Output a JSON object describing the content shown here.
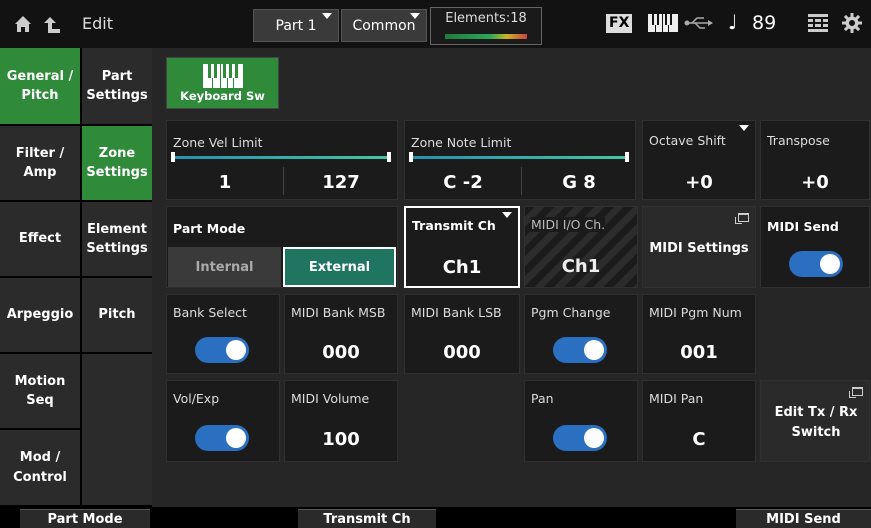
{
  "header": {
    "title": "Edit",
    "part_button": "Part 1",
    "common_button": "Common",
    "elements_label": "Elements:18",
    "fx_label": "FX",
    "note_symbol": "♩",
    "tempo": "89"
  },
  "left_nav": {
    "primary": [
      "General / Pitch",
      "Filter / Amp",
      "Effect",
      "Arpeggio",
      "Motion Seq",
      "Mod / Control"
    ],
    "secondary": [
      "Part Settings",
      "Zone Settings",
      "Element Settings",
      "Pitch"
    ],
    "selected_primary": "General / Pitch",
    "selected_secondary": "Zone Settings"
  },
  "keyboard_sw": {
    "label": "Keyboard Sw"
  },
  "zone_vel_limit": {
    "title": "Zone Vel Limit",
    "low": "1",
    "high": "127"
  },
  "zone_note_limit": {
    "title": "Zone Note Limit",
    "low": "C -2",
    "high": "G 8"
  },
  "octave_shift": {
    "title": "Octave Shift",
    "value": "+0"
  },
  "transpose": {
    "title": "Transpose",
    "value": "+0"
  },
  "part_mode": {
    "title": "Part Mode",
    "options": [
      "Internal",
      "External"
    ],
    "selected": "External"
  },
  "transmit_ch": {
    "title": "Transmit Ch",
    "value": "Ch1"
  },
  "midi_io_ch": {
    "title": "MIDI I/O Ch.",
    "value": "Ch1"
  },
  "midi_settings": {
    "label": "MIDI Settings"
  },
  "midi_send": {
    "title": "MIDI Send",
    "on": true
  },
  "bank_select": {
    "title": "Bank Select",
    "on": true
  },
  "midi_bank_msb": {
    "title": "MIDI Bank MSB",
    "value": "000"
  },
  "midi_bank_lsb": {
    "title": "MIDI Bank LSB",
    "value": "000"
  },
  "pgm_change": {
    "title": "Pgm Change",
    "on": true
  },
  "midi_pgm_num": {
    "title": "MIDI Pgm Num",
    "value": "001"
  },
  "vol_exp": {
    "title": "Vol/Exp",
    "on": true
  },
  "midi_volume": {
    "title": "MIDI Volume",
    "value": "100"
  },
  "pan": {
    "title": "Pan",
    "on": true
  },
  "midi_pan": {
    "title": "MIDI Pan",
    "value": "C"
  },
  "edit_tx_rx": {
    "label": "Edit Tx / Rx Switch"
  },
  "bottom": {
    "left": "Part Mode",
    "center": "Transmit Ch",
    "right": "MIDI Send"
  },
  "colors": {
    "accent_green": "#2f8a3a",
    "toggle_blue": "#2a6fc0",
    "slider_cyan": "#46c6a0"
  }
}
